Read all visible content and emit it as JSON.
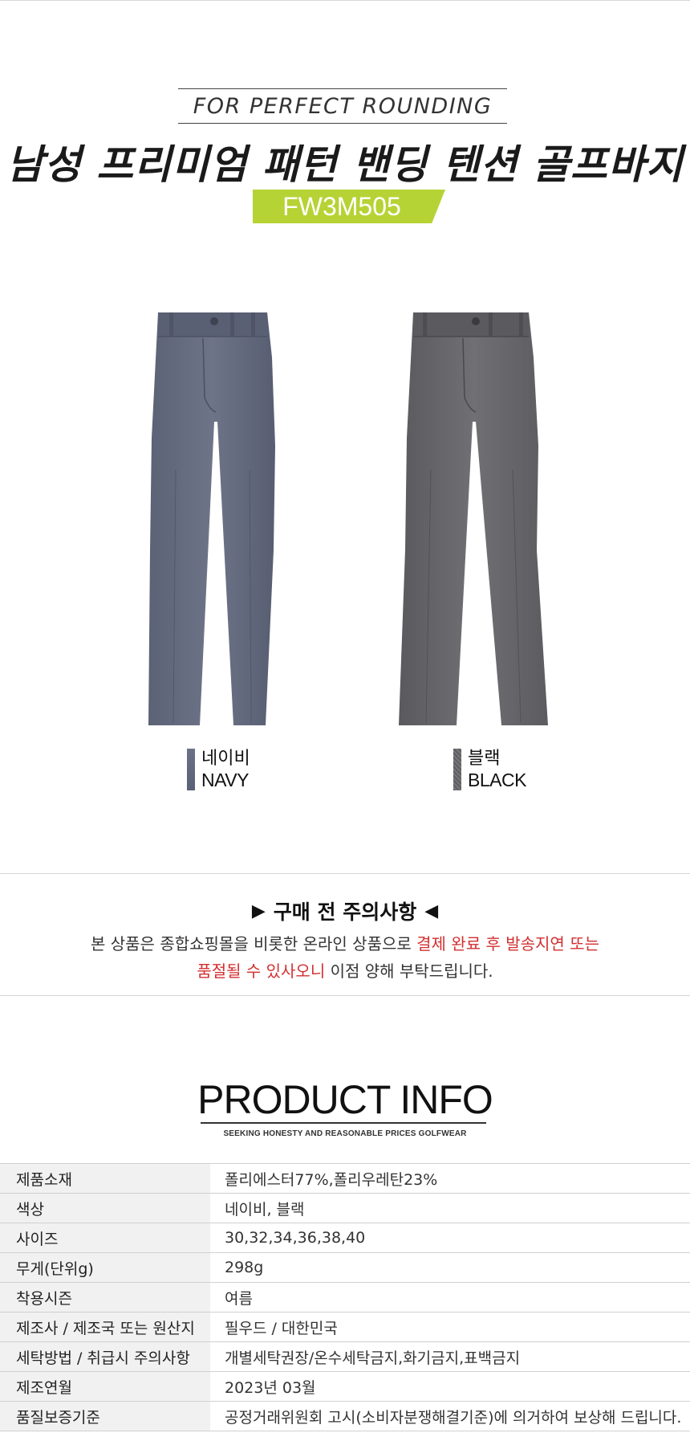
{
  "header": {
    "tagline": "FOR PERFECT ROUNDING",
    "title": "남성 프리미엄 패턴 밴딩 텐션 골프바지",
    "product_code": "FW3M505"
  },
  "colors": [
    {
      "ko": "네이비",
      "en": "NAVY",
      "hex": "#5f6679"
    },
    {
      "ko": "블랙",
      "en": "BLACK",
      "hex": "#626266"
    }
  ],
  "notice": {
    "title": "구매 전 주의사항",
    "line1_normal": "본 상품은 종합쇼핑몰을 비롯한 온라인 상품으로 ",
    "line1_red": "결제 완료 후 발송지연 또는",
    "line2_red": "품절될 수 있사오니",
    "line2_normal": " 이점 양해 부탁드립니다."
  },
  "product_info": {
    "title": "PRODUCT INFO",
    "subtitle": "SEEKING HONESTY AND REASONABLE PRICES GOLFWEAR",
    "rows": [
      {
        "label": "제품소재",
        "value": "폴리에스터77%,폴리우레탄23%"
      },
      {
        "label": "색상",
        "value": "네이비, 블랙"
      },
      {
        "label": "사이즈",
        "value": "30,32,34,36,38,40"
      },
      {
        "label": "무게(단위g)",
        "value": "298g"
      },
      {
        "label": "착용시즌",
        "value": "여름"
      },
      {
        "label": "제조사 / 제조국 또는 원산지",
        "value": "필우드 / 대한민국"
      },
      {
        "label": "세탁방법 / 취급시 주의사항",
        "value": "개별세탁권장/온수세탁금지,화기금지,표백금지"
      },
      {
        "label": "제조연월",
        "value": "2023년 03월"
      },
      {
        "label": "품질보증기준",
        "value": "공정거래위원회 고시(소비자분쟁해결기준)에 의거하여 보상해 드립니다."
      }
    ]
  }
}
